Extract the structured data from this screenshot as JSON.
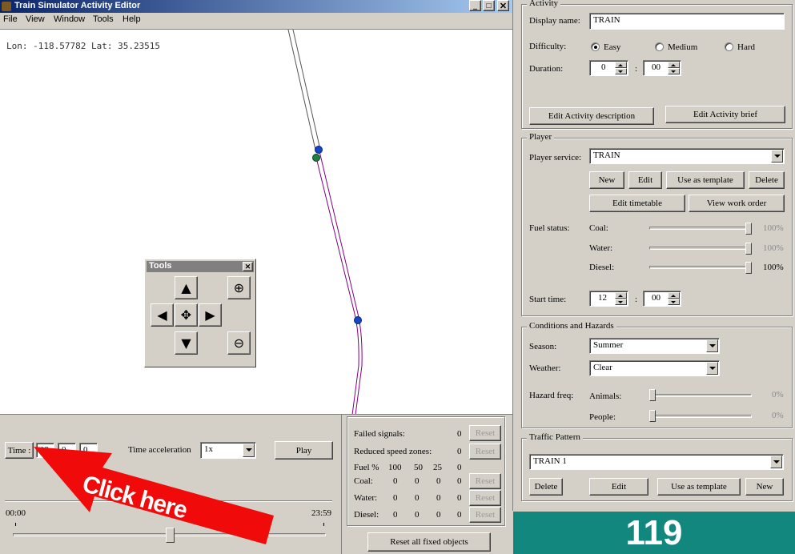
{
  "app": {
    "title": "Train Simulator Activity Editor"
  },
  "menu": [
    "File",
    "View",
    "Window",
    "Tools",
    "Help"
  ],
  "map": {
    "coords": "Lon: -118.57782 Lat: 35.23515"
  },
  "tools": {
    "title": "Tools"
  },
  "time_panel": {
    "time_label": "Time :",
    "hour": "12",
    "minute": "0",
    "second": "0",
    "accel_label": "Time acceleration",
    "accel_value": "1x",
    "play_label": "Play",
    "start_time": "00:00",
    "end_time": "23:59"
  },
  "overlay": {
    "callout": "Click here",
    "badge": "119"
  },
  "stats": {
    "failed_signals_label": "Failed signals:",
    "failed_signals": "0",
    "reduced_label": "Reduced speed zones:",
    "reduced": "0",
    "fuel_label": "Fuel %",
    "fuel_cols": [
      "100",
      "50",
      "25",
      "0"
    ],
    "rows": [
      {
        "label": "Coal:",
        "vals": [
          "0",
          "0",
          "0",
          "0"
        ]
      },
      {
        "label": "Water:",
        "vals": [
          "0",
          "0",
          "0",
          "0"
        ]
      },
      {
        "label": "Diesel:",
        "vals": [
          "0",
          "0",
          "0",
          "0"
        ]
      }
    ],
    "reset_label": "Reset",
    "reset_all_label": "Reset all fixed objects"
  },
  "activity": {
    "title": "Activity",
    "display_name_label": "Display name:",
    "display_name": "TRAIN",
    "difficulty_label": "Difficulty:",
    "easy": "Easy",
    "medium": "Medium",
    "hard": "Hard",
    "duration_label": "Duration:",
    "dur_hours": "0",
    "dur_minutes": "00",
    "edit_desc": "Edit Activity description",
    "edit_brief": "Edit Activity brief"
  },
  "player": {
    "title": "Player",
    "service_label": "Player service:",
    "service": "TRAIN",
    "new": "New",
    "edit": "Edit",
    "use_template": "Use as template",
    "delete": "Delete",
    "edit_timetable": "Edit timetable",
    "view_work_order": "View work order",
    "fuel_label": "Fuel status:",
    "coal_label": "Coal:",
    "coal_pct": "100%",
    "coal_level": 1.0,
    "water_label": "Water:",
    "water_pct": "100%",
    "water_level": 1.0,
    "diesel_label": "Diesel:",
    "diesel_pct": "100%",
    "diesel_level": 1.0,
    "start_time_label": "Start time:",
    "start_hours": "12",
    "start_minutes": "00"
  },
  "conditions": {
    "title": "Conditions and Hazards",
    "season_label": "Season:",
    "season": "Summer",
    "weather_label": "Weather:",
    "weather": "Clear",
    "hazard_label": "Hazard freq:",
    "animals_label": "Animals:",
    "animals_pct": "0%",
    "animals_level": 0,
    "people_label": "People:",
    "people_pct": "0%",
    "people_level": 0
  },
  "traffic": {
    "title": "Traffic Pattern",
    "pattern": "TRAIN 1",
    "delete": "Delete",
    "edit": "Edit",
    "use_template": "Use as template",
    "new": "New"
  }
}
